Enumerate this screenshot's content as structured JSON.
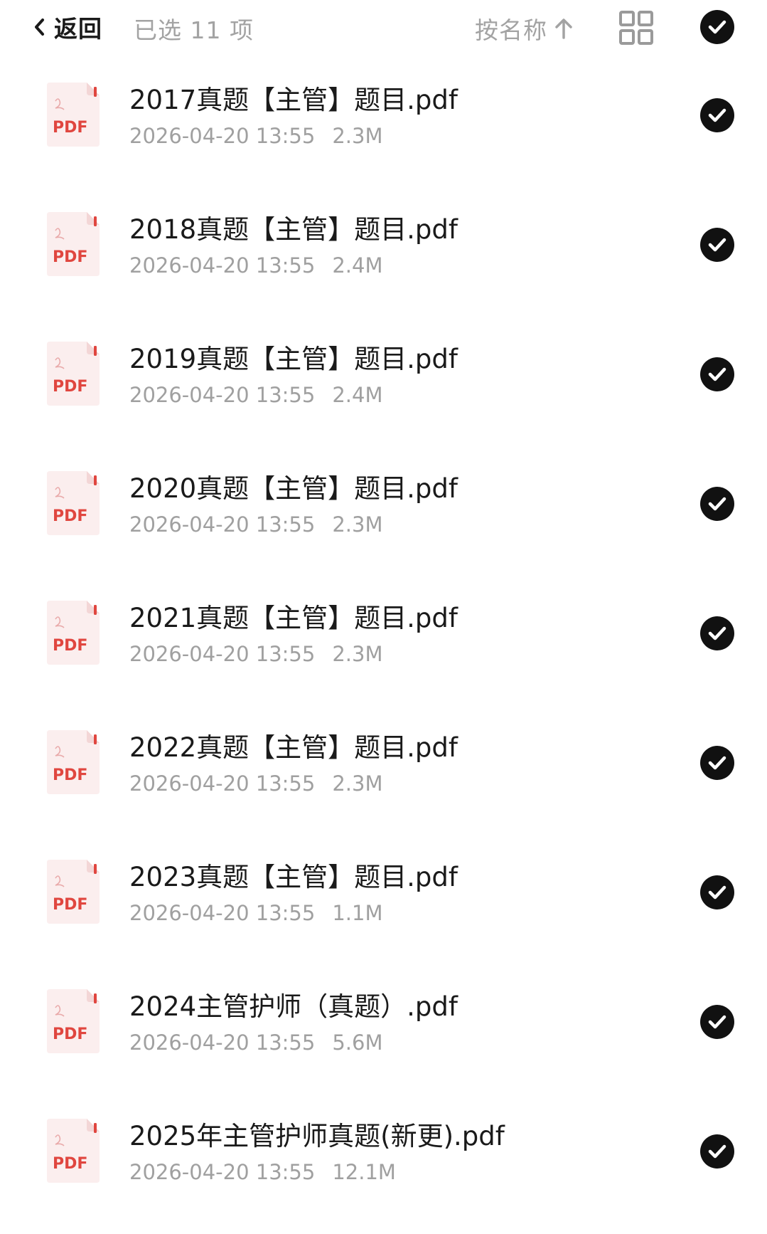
{
  "header": {
    "back_label": "返回",
    "selected_text": "已选 11 项",
    "sort_label": "按名称"
  },
  "icons": {
    "back": "chevron-left-icon",
    "sort": "arrow-up-icon",
    "grid": "grid-view-icon",
    "check": "check-circle-icon",
    "file": "pdf-file-icon"
  },
  "pdf_icon_label": "PDF",
  "colors": {
    "primary_text": "#1a1a1a",
    "secondary_text": "#a0a0a0",
    "check_fill": "#111111",
    "pdf_red": "#e0463f",
    "pdf_bg": "#fbeeee"
  },
  "files": [
    {
      "name": "2017真题【主管】题目.pdf",
      "date": "2026-04-20 13:55",
      "size": "2.3M"
    },
    {
      "name": "2018真题【主管】题目.pdf",
      "date": "2026-04-20 13:55",
      "size": "2.4M"
    },
    {
      "name": "2019真题【主管】题目.pdf",
      "date": "2026-04-20 13:55",
      "size": "2.4M"
    },
    {
      "name": "2020真题【主管】题目.pdf",
      "date": "2026-04-20 13:55",
      "size": "2.3M"
    },
    {
      "name": "2021真题【主管】题目.pdf",
      "date": "2026-04-20 13:55",
      "size": "2.3M"
    },
    {
      "name": "2022真题【主管】题目.pdf",
      "date": "2026-04-20 13:55",
      "size": "2.3M"
    },
    {
      "name": "2023真题【主管】题目.pdf",
      "date": "2026-04-20 13:55",
      "size": "1.1M"
    },
    {
      "name": "2024主管护师（真题）.pdf",
      "date": "2026-04-20 13:55",
      "size": "5.6M"
    },
    {
      "name": "2025年主管护师真题(新更).pdf",
      "date": "2026-04-20 13:55",
      "size": "12.1M"
    }
  ]
}
